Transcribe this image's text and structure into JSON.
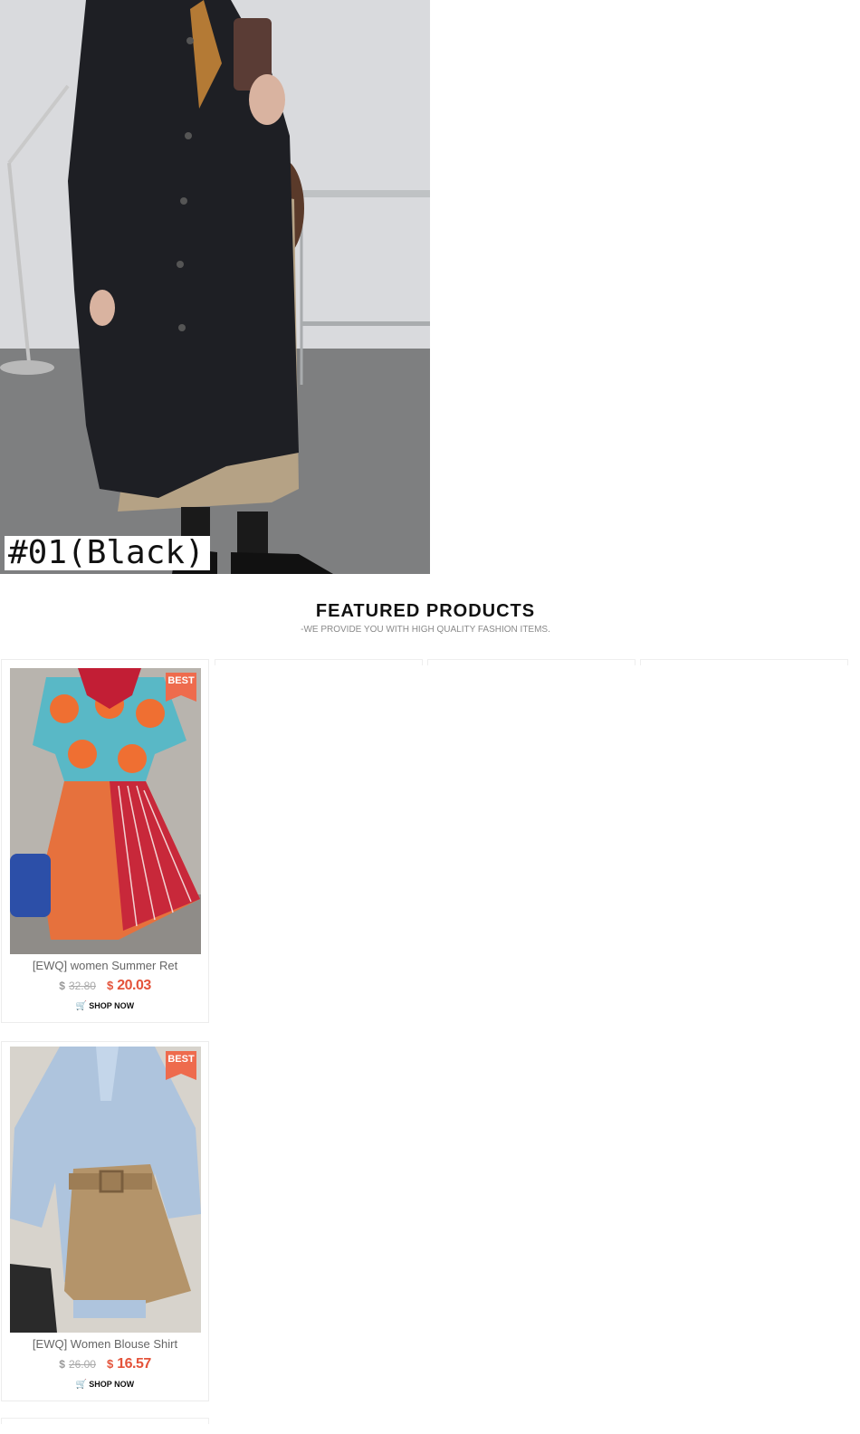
{
  "hero": {
    "variant_label": "#01(Black)",
    "image_alt": "Woman in long black trench coat with khaki pleated skirt"
  },
  "featured": {
    "title": "FEATURED PRODUCTS",
    "subtitle": "-WE PROVIDE YOU WITH HIGH QUALITY FASHION ITEMS."
  },
  "products": [
    {
      "badge": "BEST",
      "name": "[EWQ] women Summer Ret",
      "old_currency": "$",
      "old_price": "32.80",
      "new_currency": "$",
      "new_price": "20.03",
      "cta": "SHOP NOW"
    },
    {
      "badge": "BEST",
      "name": "[EWQ] Women Blouse Shirt",
      "old_currency": "$",
      "old_price": "26.00",
      "new_currency": "$",
      "new_price": "16.57",
      "cta": "SHOP NOW"
    }
  ],
  "colors": {
    "accent_price": "#e4533a",
    "badge": "#ee6b4d",
    "muted_text": "#8a8a8a"
  },
  "icons": [
    "cart-icon"
  ]
}
